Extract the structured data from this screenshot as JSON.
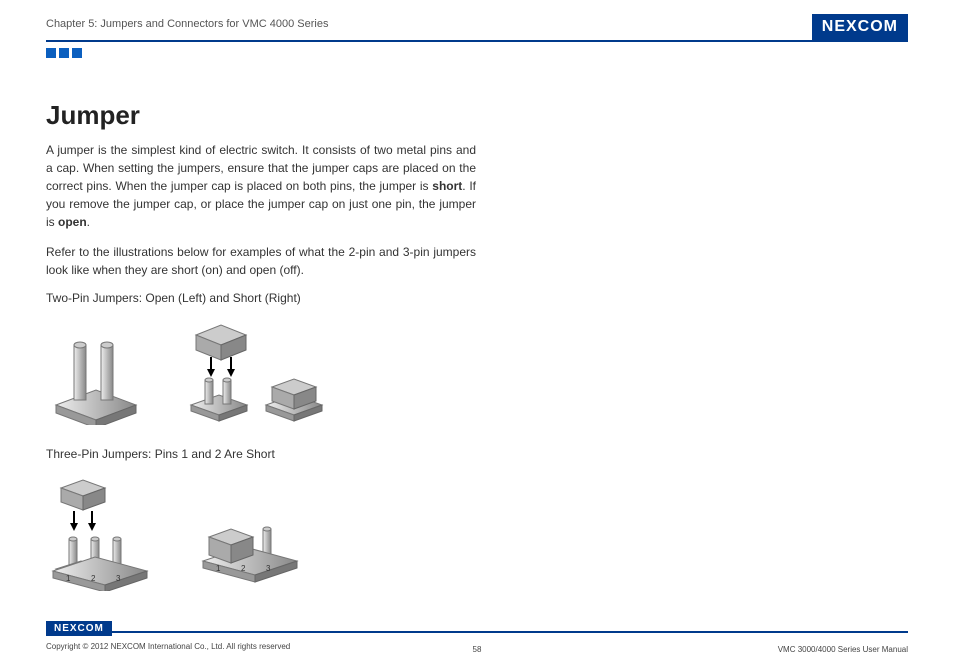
{
  "header": {
    "chapter": "Chapter 5: Jumpers and Connectors for VMC 4000 Series",
    "logo": "NEXCOM"
  },
  "content": {
    "heading": "Jumper",
    "p1_pre": "A jumper is the simplest kind of electric switch. It consists of two metal pins and a cap. When setting the jumpers, ensure that the jumper caps are placed on the correct pins. When the jumper cap is placed on both pins, the jumper is ",
    "p1_bold1": "short",
    "p1_mid": ". If you remove the jumper cap, or place the jumper cap on just one pin, the jumper is ",
    "p1_bold2": "open",
    "p1_post": ".",
    "p2": "Refer to the illustrations below for examples of what the 2-pin and 3-pin jumpers look like when they are short (on) and open (off).",
    "caption1": "Two-Pin Jumpers: Open (Left) and Short (Right)",
    "caption2": "Three-Pin Jumpers: Pins 1 and 2 Are Short"
  },
  "footer": {
    "logo": "NEXCOM",
    "copyright": "Copyright © 2012 NEXCOM International Co., Ltd. All rights reserved",
    "page": "58",
    "manual": "VMC 3000/4000 Series User Manual"
  }
}
